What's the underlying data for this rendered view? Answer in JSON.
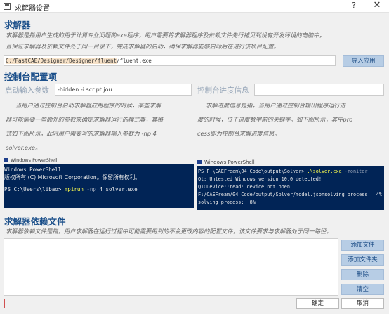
{
  "window": {
    "title": "求解器设置",
    "help_glyph": "?",
    "close_glyph": "✕"
  },
  "solver": {
    "heading": "求解器",
    "description_line1": "求解器是指用户生成的用于计算专业问题的exe程序，用户需要将求解器程序及依赖文件先行拷贝到设有开发环境的电脑中，",
    "description_line2": "且保证求解器及依赖文件处于同一目录下，完成求解器的启动，确保求解器能够启动后在进行该项目配置。",
    "path_highlight": "C:/FastCAE/Designer/Designer/fluent",
    "path_rest": "/fluent.exe",
    "import_button": "导入应用"
  },
  "console": {
    "heading": "控制台配置项",
    "startup_label": "启动输入参数",
    "startup_value": "-hidden -i script jou",
    "progress_label": "控制台进度信息",
    "progress_value": "",
    "startup_desc": [
      "当用户通过控制台启动求解器应用程序的时候，某些求解",
      "器可能需要一些额外的参数来确定求解器运行的模式等，其格",
      "式如下图所示，此时用户需要写的求解器输入参数为 -np 4",
      "solver.exe。"
    ],
    "progress_desc": [
      "求解进度信息是指，当用户通过控制台输出程序运行进",
      "度的时候，位于进度数字前的关键字。如下图所示，其中pro",
      "cess即为控制台求解进度信息。"
    ]
  },
  "ps_left": {
    "title": "Windows PowerShell",
    "line1": "Windows PowerShell",
    "line2": "版权所有 (C) Microsoft Corporation。保留所有权利。",
    "prompt": "PS C:\\Users\\libao> ",
    "cmd": "mpirun",
    "arg1": " -np",
    "arg2": " 4 solver.exe"
  },
  "ps_right": {
    "title": "Windows PowerShell",
    "prompt": "PS F:\\CAEFream\\04_Code\\output\\Solver> ",
    "cmd": ".\\solver.exe",
    "flag": " -monitor",
    "line2": "Qt: Untested Windows version 10.0 detected!",
    "line3": "QIODevice::read: device not open",
    "line4": "F:/CAEFream/04_Code/output/Solver/model.jsonsolving process:  4%",
    "line5": "solving process:  8%"
  },
  "deps": {
    "heading": "求解器依赖文件",
    "description": "求解器依赖文件是指，用户求解器在运行过程中可能需要用到的不会更改内容的配置文件，该文件要求与求解器处于同一路径。",
    "add_file": "添加文件",
    "add_folder": "添加文件夹",
    "delete": "删除",
    "clear": "清空"
  },
  "footer": {
    "ok": "确定",
    "cancel": "取消"
  }
}
